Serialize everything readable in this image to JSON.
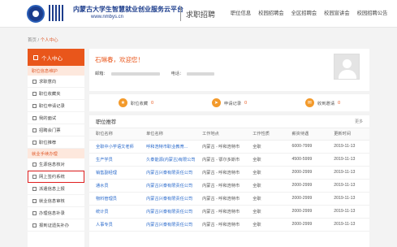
{
  "header": {
    "site_title": "内蒙古大学生智慧就业创业服务云平台",
    "site_url": "www.nmbys.cn",
    "section_title": "求职招聘",
    "nav": [
      "职位信息",
      "校园招聘会",
      "全区招聘会",
      "校园宣讲会",
      "校园招聘公告"
    ]
  },
  "breadcrumb": {
    "home": "首页",
    "sep": "/",
    "current": "个人中心"
  },
  "sidebar": {
    "title": "个人中心",
    "groups": [
      {
        "label": "职位信息维护",
        "items": [
          "求职意向",
          "职位收藏夹",
          "职位申请记录",
          "我的面试",
          "招聘会门票",
          "职位推荐"
        ]
      },
      {
        "label": "就业手续办理",
        "items": [
          "生源信息核对",
          "网上签约系统",
          "派遣信息上报",
          "就业信息审核",
          "办理信息补录",
          "报到证遗失补办"
        ]
      }
    ],
    "highlighted": "网上签约系统"
  },
  "welcome": {
    "text": "石琳春，欢迎您！",
    "email_label": "邮箱：",
    "phone_label": "电话："
  },
  "stats": [
    {
      "label": "职位收藏",
      "value": "0",
      "icon": "star-icon"
    },
    {
      "label": "申请记录",
      "value": "0",
      "icon": "send-icon"
    },
    {
      "label": "收到邀请",
      "value": "0",
      "icon": "mail-icon"
    }
  ],
  "jobs": {
    "title": "职位推荐",
    "more": "更多",
    "columns": [
      "职位名称",
      "单位名称",
      "工作地点",
      "工作性质",
      "薪资待遇",
      "更新时间"
    ],
    "rows": [
      [
        "全职中小学语文老师",
        "呼和浩特市职业教育...",
        "内蒙古 - 呼和浩特市",
        "全职",
        "6000-7999",
        "2019-11-13"
      ],
      [
        "生产学员",
        "久泰能源(内蒙古)有限公司",
        "内蒙古 - 鄂尔多斯市",
        "全职",
        "4500-5999",
        "2019-11-13"
      ],
      [
        "销售副经理",
        "内蒙古兴泰有限责任公司",
        "内蒙古 - 呼和浩特市",
        "全职",
        "2000-2999",
        "2019-11-13"
      ],
      [
        "通水员",
        "内蒙古兴泰有限责任公司",
        "内蒙古 - 呼和浩特市",
        "全职",
        "2000-2999",
        "2019-11-13"
      ],
      [
        "物料管理员",
        "内蒙古兴泰有限责任公司",
        "内蒙古 - 呼和浩特市",
        "全职",
        "2000-2999",
        "2019-11-13"
      ],
      [
        "统计员",
        "内蒙古兴泰有限责任公司",
        "内蒙古 - 呼和浩特市",
        "全职",
        "2000-2999",
        "2019-11-13"
      ],
      [
        "人事专员",
        "内蒙古兴泰有限责任公司",
        "内蒙古 - 呼和浩特市",
        "全职",
        "2000-2999",
        "2019-11-13"
      ]
    ]
  },
  "colors": {
    "accent": "#e9561b",
    "brand": "#1c3d8c",
    "link": "#2a6acb",
    "highlight_box": "#e02020"
  }
}
